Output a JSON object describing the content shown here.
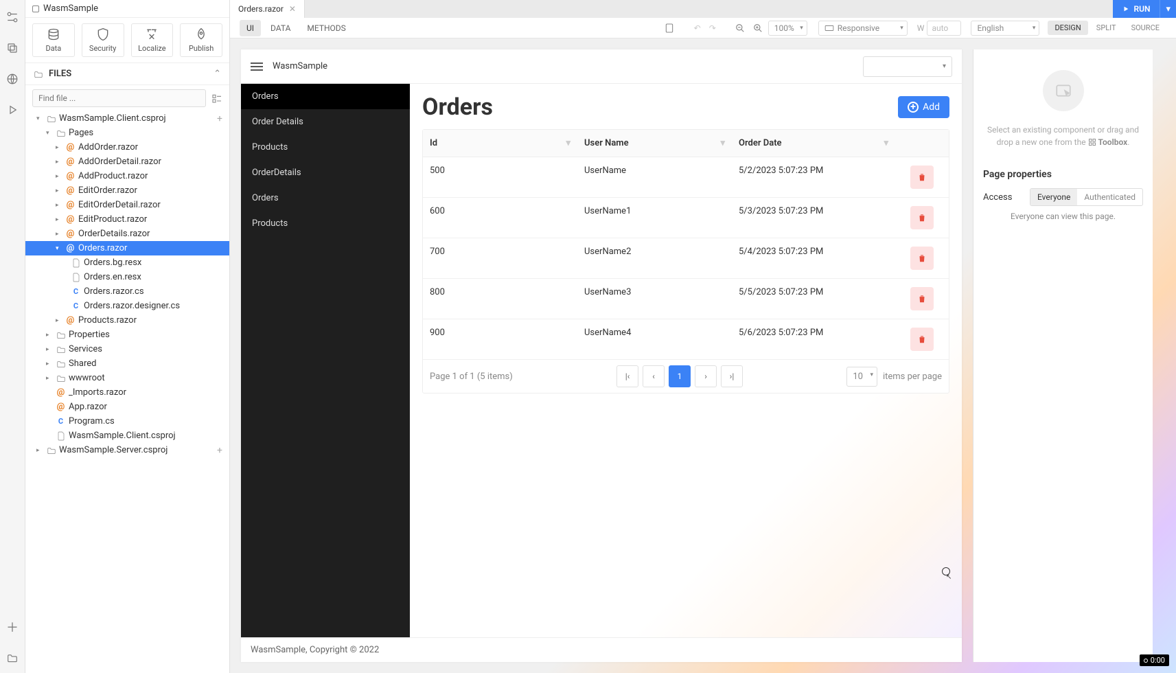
{
  "app": {
    "name": "WasmSample"
  },
  "sideToolbar": [
    {
      "label": "Data"
    },
    {
      "label": "Security"
    },
    {
      "label": "Localize"
    },
    {
      "label": "Publish"
    }
  ],
  "filesHeader": "FILES",
  "searchPlaceholder": "Find file ...",
  "tree": {
    "proj1": "WasmSample.Client.csproj",
    "pages": "Pages",
    "items": [
      "AddOrder.razor",
      "AddOrderDetail.razor",
      "AddProduct.razor",
      "EditOrder.razor",
      "EditOrderDetail.razor",
      "EditProduct.razor",
      "OrderDetails.razor"
    ],
    "selected": "Orders.razor",
    "children": [
      "Orders.bg.resx",
      "Orders.en.resx",
      "Orders.razor.cs",
      "Orders.razor.designer.cs"
    ],
    "after": "Products.razor",
    "folders": [
      "Properties",
      "Services",
      "Shared",
      "wwwroot"
    ],
    "rootFiles": [
      "_Imports.razor",
      "App.razor",
      "Program.cs",
      "WasmSample.Client.csproj"
    ],
    "proj2": "WasmSample.Server.csproj"
  },
  "tab": {
    "name": "Orders.razor"
  },
  "run": "RUN",
  "subtabs": [
    "UI",
    "DATA",
    "METHODS"
  ],
  "zoom": "100%",
  "device": "Responsive",
  "wLabel": "W",
  "wValue": "auto",
  "lang": "English",
  "viewtabs": [
    "DESIGN",
    "SPLIT",
    "SOURCE"
  ],
  "preview": {
    "brand": "WasmSample",
    "nav": [
      "Orders",
      "Order Details",
      "Products",
      "OrderDetails",
      "Orders",
      "Products"
    ],
    "page": {
      "title": "Orders",
      "addLabel": "Add",
      "columns": [
        "Id",
        "User Name",
        "Order Date"
      ],
      "rows": [
        {
          "id": "500",
          "user": "UserName",
          "date": "5/2/2023 5:07:23 PM"
        },
        {
          "id": "600",
          "user": "UserName1",
          "date": "5/3/2023 5:07:23 PM"
        },
        {
          "id": "700",
          "user": "UserName2",
          "date": "5/4/2023 5:07:23 PM"
        },
        {
          "id": "800",
          "user": "UserName3",
          "date": "5/5/2023 5:07:23 PM"
        },
        {
          "id": "900",
          "user": "UserName4",
          "date": "5/6/2023 5:07:23 PM"
        }
      ],
      "pager": {
        "info": "Page 1 of 1 (5 items)",
        "current": "1",
        "size": "10",
        "itemsLabel": "items per page"
      }
    },
    "footer": "WasmSample, Copyright © 2022"
  },
  "right": {
    "hint1": "Select an existing component or drag and drop a new one from the ",
    "toolbox": "Toolbox",
    "propsTitle": "Page properties",
    "accessLabel": "Access",
    "seg": [
      "Everyone",
      "Authenticated"
    ],
    "note": "Everyone can view this page."
  },
  "badge": "0:00"
}
